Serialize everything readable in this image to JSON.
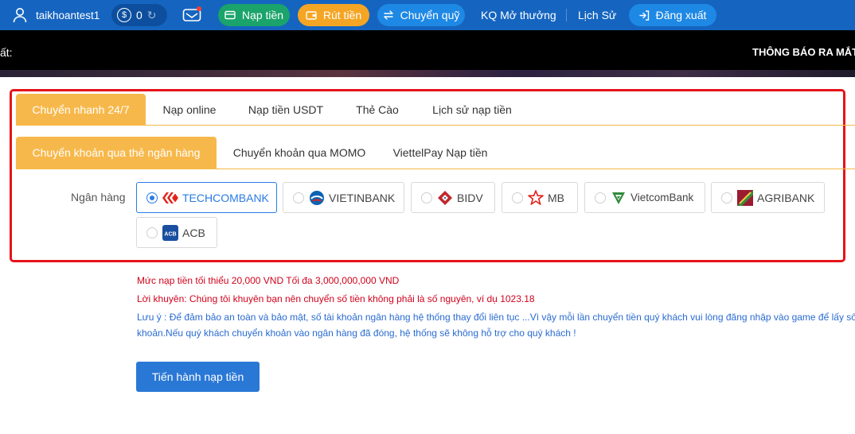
{
  "header": {
    "username": "taikhoantest1",
    "balance": "0",
    "deposit_label": "Nạp tiền",
    "withdraw_label": "Rút tiền",
    "transfer_label": "Chuyển quỹ",
    "results_label": "KQ Mở thưởng",
    "history_label": "Lịch Sử",
    "logout_label": "Đăng xuất",
    "icons": [
      "user-icon",
      "coin-icon",
      "refresh-icon",
      "mail-icon",
      "card-icon",
      "wallet-icon",
      "transfer-icon",
      "logout-icon"
    ],
    "colors": {
      "bar": "#1565c0",
      "deposit": "#1aa36a",
      "withdraw": "#f5a524",
      "transfer": "#1e88e5",
      "logout": "#1e88e5"
    }
  },
  "marquee": {
    "left_text": "ất:",
    "right_text": "THÔNG BÁO RA MẮT"
  },
  "deposit": {
    "main_tabs": [
      "Chuyển nhanh 24/7",
      "Nạp online",
      "Nạp tiền USDT",
      "Thẻ Cào",
      "Lịch sử nạp tiền"
    ],
    "active_main_tab": "Chuyển nhanh 24/7",
    "sub_tabs": [
      "Chuyển khoản qua thẻ ngân hàng",
      "Chuyển khoản qua MOMO",
      "ViettelPay Nạp tiền"
    ],
    "active_sub_tab": "Chuyển khoản qua thẻ ngân hàng",
    "bank_label": "Ngân hàng",
    "banks": [
      "TECHCOMBANK",
      "VIETINBANK",
      "BIDV",
      "MB",
      "VietcomBank",
      "AGRIBANK",
      "ACB"
    ],
    "selected_bank": "TECHCOMBANK",
    "accent_color": "#f7b84b"
  },
  "notes": {
    "limit": "Mức nạp tiền tối thiểu 20,000 VND Tối đa 3,000,000,000 VND",
    "advice": "Lời khuyên: Chúng tôi khuyên bạn nên chuyển số tiền không phải là số nguyên, ví dụ 1023.18",
    "warning_line1": "Lưu ý : Để đảm bảo an toàn và bảo mật, số tài khoản ngân hàng hệ thống thay đổi liên tục ...Vì vậy mỗi lần chuyển tiền quý khách vui lòng đăng nhập vào game để lấy số",
    "warning_line2": "khoản.Nếu quý khách chuyển khoản vào ngân hàng đã đóng, hệ thống sẽ không hỗ trợ cho quý khách !"
  },
  "submit_label": "Tiến hành nạp tiền"
}
